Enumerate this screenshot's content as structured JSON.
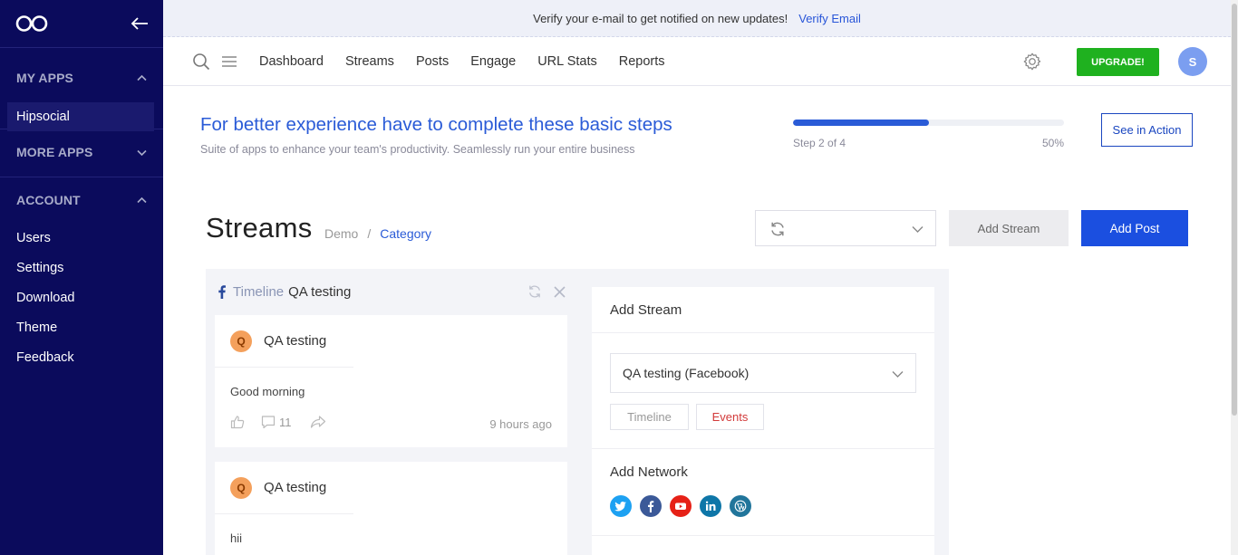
{
  "sidebar": {
    "my_apps": "MY APPS",
    "active_app": "Hipsocial",
    "more_apps": "MORE APPS",
    "account": "ACCOUNT",
    "items": [
      "Users",
      "Settings",
      "Download",
      "Theme",
      "Feedback"
    ]
  },
  "verify": {
    "message": "Verify your e-mail to get notified on new updates!",
    "link": "Verify Email"
  },
  "nav": {
    "links": [
      "Dashboard",
      "Streams",
      "Posts",
      "Engage",
      "URL Stats",
      "Reports"
    ],
    "upgrade": "UPGRADE!",
    "avatar_initial": "S"
  },
  "onboarding": {
    "title": "For better experience have to complete these basic steps",
    "subtitle": "Suite of apps to enhance your team's productivity. Seamlessly run your entire business",
    "step_text": "Step 2 of 4",
    "percent_label": "50%",
    "progress": 0.5,
    "cta": "See in Action"
  },
  "streams": {
    "title": "Streams",
    "breadcrumb": [
      "Demo",
      "Category"
    ],
    "add_stream_btn": "Add Stream",
    "add_post_btn": "Add Post"
  },
  "column": {
    "type_label": "Timeline",
    "name": "QA testing",
    "posts": [
      {
        "initial": "Q",
        "author": "QA testing",
        "body": "Good morning",
        "comments": "11",
        "time": "9 hours ago"
      },
      {
        "initial": "Q",
        "author": "QA testing",
        "body": "hii"
      }
    ]
  },
  "add_stream_panel": {
    "title": "Add Stream",
    "account_value": "QA testing (Facebook)",
    "tags": [
      "Timeline",
      "Events"
    ],
    "add_network": "Add Network",
    "networks": [
      {
        "icon": "twitter-icon",
        "color": "#1da1f2"
      },
      {
        "icon": "facebook-icon",
        "color": "#3b5998"
      },
      {
        "icon": "youtube-icon",
        "color": "#e62117"
      },
      {
        "icon": "linkedin-icon",
        "color": "#0e76a8"
      },
      {
        "icon": "wordpress-icon",
        "color": "#21759b"
      }
    ]
  },
  "colors": {
    "sidebar_bg": "#0b0b5c",
    "accent": "#2a5bd7",
    "upgrade": "#1fb11f",
    "primary_button": "#1b4fe0"
  }
}
